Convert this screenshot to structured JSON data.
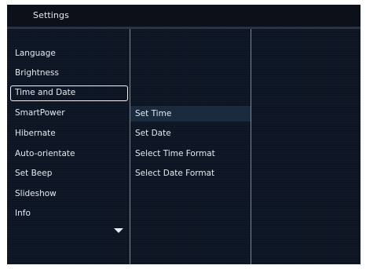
{
  "header": {
    "title": "Settings"
  },
  "menu": {
    "items": [
      {
        "label": "Language",
        "selected": false
      },
      {
        "label": "Brightness",
        "selected": false
      },
      {
        "label": "Time and Date",
        "selected": true
      },
      {
        "label": "SmartPower",
        "selected": false
      },
      {
        "label": "Hibernate",
        "selected": false
      },
      {
        "label": "Auto-orientate",
        "selected": false
      },
      {
        "label": "Set Beep",
        "selected": false
      },
      {
        "label": "Slideshow",
        "selected": false
      },
      {
        "label": "Info",
        "selected": false
      }
    ],
    "more_icon": "chevron-down-icon"
  },
  "submenu": {
    "items": [
      {
        "label": "Set Time",
        "highlighted": true
      },
      {
        "label": "Set Date",
        "highlighted": false
      },
      {
        "label": "Select Time Format",
        "highlighted": false
      },
      {
        "label": "Select Date Format",
        "highlighted": false
      }
    ]
  },
  "colors": {
    "background": "#0d1624",
    "text": "#e4e9ef",
    "selection_border": "#f2f2f2",
    "highlight": "#1a2b40"
  }
}
